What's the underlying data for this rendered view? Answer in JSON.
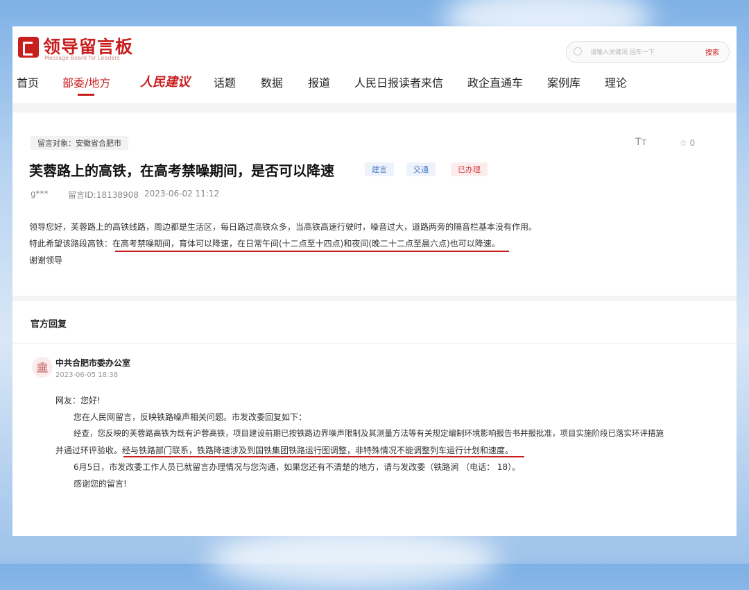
{
  "site": {
    "logo_text": "领导留言板",
    "logo_sub": "Message Board for Leaders",
    "search_placeholder": "请输入关键词 回车一下",
    "search_button": "搜索"
  },
  "nav": [
    "首页",
    "部委/地方",
    "人民建议",
    "话题",
    "数据",
    "报道",
    "人民日报读者来信",
    "政企直通车",
    "案例库",
    "理论"
  ],
  "message": {
    "target": "留言对象：安徽省合肥市",
    "font_tool": "Tт",
    "favorite": "☆ 0",
    "title": "芙蓉路上的高铁，在高考禁噪期间，是否可以降速",
    "tags": [
      "建言",
      "交通",
      "已办理"
    ],
    "user": "g***",
    "message_id": "留言ID:18138908",
    "time": "2023-06-02 11:12",
    "body": [
      "领导您好，芙蓉路上的高铁线路，周边都是生活区，每日路过高铁众多，当高铁高速行驶时，噪音过大，道路两旁的隔音栏基本没有作用。",
      "特此希望该路段高铁：在高考禁噪期间，育体可以降速，在日常午间(十二点至十四点)和夜间(晚二十二点至晨六点)也可以降速。",
      "谢谢领导"
    ]
  },
  "reply": {
    "heading": "官方回复",
    "org": "中共合肥市委办公室",
    "time": "2023-06-05 18:38",
    "lines": [
      "网友：您好!",
      "您在人民网留言，反映铁路噪声相关问题。市发改委回复如下：",
      "经查，您反映的芙蓉路高铁为既有沪蓉高铁，项目建设前期已按铁路边界噪声限制及其测量方法等有关规定编制环境影响报告书并报批准，项目实施阶段已落实环评措施",
      "并通过环评验收。经与铁路部门联系，铁路降速涉及到国铁集团铁路运行图调整，非特殊情况不能调整列车运行计划和速度。",
      "6月5日，市发改委工作人员已就留言办理情况与您沟通，如果您还有不清楚的地方，请与发改委（铁路涧     （电话：          18）。",
      "感谢您的留言!"
    ]
  }
}
